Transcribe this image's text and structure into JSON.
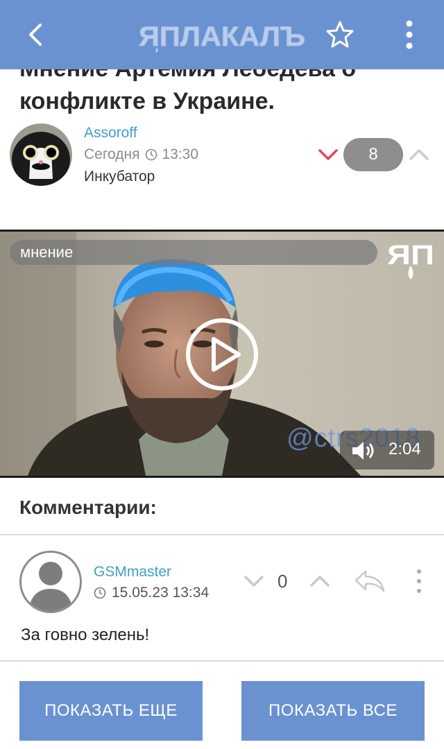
{
  "app": {
    "logo_text": "ЯПЛАКАЛЪ",
    "accent": "#6b92d0",
    "icons": [
      "back-arrow-icon",
      "star-icon",
      "more-vertical-icon"
    ]
  },
  "post": {
    "title": "Мнение Артемия Лебедева о конфликте в Украине.",
    "author": "Assoroff",
    "date": "Сегодня",
    "time": "13:30",
    "category": "Инкубатор",
    "rating": "8"
  },
  "video": {
    "tag": "мнение",
    "logo": "ЯП",
    "watermark": "@ctrs2018",
    "duration": "2:04"
  },
  "comments": {
    "heading": "Комментарии:",
    "items": [
      {
        "author": "GSMmaster",
        "datetime": "15.05.23 13:34",
        "rating": "0",
        "text": "За говно зелень!"
      }
    ]
  },
  "buttons": {
    "show_more": "ПОКАЗАТЬ ЕЩЕ",
    "show_all": "ПОКАЗАТЬ ВСЕ"
  }
}
